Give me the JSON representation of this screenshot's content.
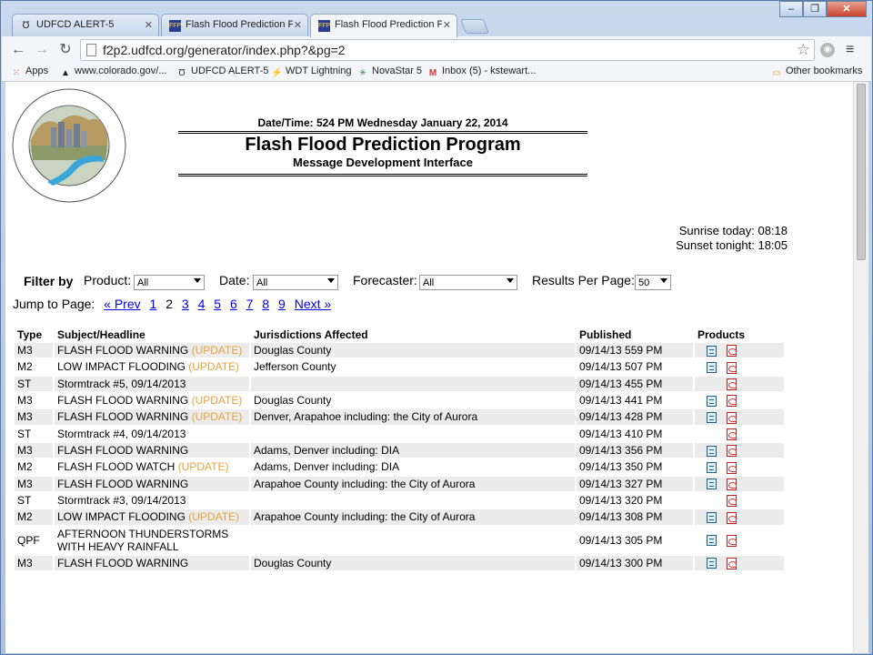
{
  "browser": {
    "tabs": [
      {
        "title": "UDFCD ALERT-5",
        "favicon": "udfcd-logo-icon"
      },
      {
        "title": "Flash Flood Prediction Pro",
        "favicon": "ffp-logo-icon"
      },
      {
        "title": "Flash Flood Prediction Pro",
        "favicon": "ffp-logo-icon",
        "active": true
      }
    ],
    "url": "f2p2.udfcd.org/generator/index.php?&pg=2",
    "bookmarks": [
      {
        "label": "Apps",
        "icon": "apps-grid-icon"
      },
      {
        "label": "www.colorado.gov/...",
        "icon": "colorado-icon"
      },
      {
        "label": "UDFCD ALERT-5",
        "icon": "udfcd-logo-icon"
      },
      {
        "label": "WDT Lightning",
        "icon": "lightning-icon"
      },
      {
        "label": "NovaStar 5",
        "icon": "novastar-icon"
      },
      {
        "label": "Inbox (5) - kstewart...",
        "icon": "gmail-icon"
      }
    ],
    "other_bookmarks": "Other bookmarks"
  },
  "page": {
    "datetime": "Date/Time: 524 PM Wednesday January 22, 2014",
    "title": "Flash Flood Prediction Program",
    "subtitle": "Message Development Interface",
    "sunrise": "Sunrise today: 08:18",
    "sunset": "Sunset tonight: 18:05"
  },
  "filters": {
    "filter_by": "Filter by",
    "product_label": "Product:",
    "product_value": "All",
    "date_label": "Date:",
    "date_value": "All",
    "forecaster_label": "Forecaster:",
    "forecaster_value": "All",
    "results_label": "Results Per Page:",
    "results_value": "50"
  },
  "pager": {
    "jump_label": "Jump to Page:",
    "prev": "« Prev",
    "pages": [
      "1",
      "2",
      "3",
      "4",
      "5",
      "6",
      "7",
      "8",
      "9"
    ],
    "current": "2",
    "next": "Next »"
  },
  "table": {
    "headers": [
      "Type",
      "Subject/Headline",
      "Jurisdictions Affected",
      "Published",
      "Products"
    ],
    "rows": [
      {
        "type": "M3",
        "subject": "FLASH FLOOD WARNING",
        "update": "(UPDATE)",
        "jurisdiction": "Douglas County",
        "published": "09/14/13 559 PM",
        "doc": true,
        "pdf": true
      },
      {
        "type": "M2",
        "subject": "LOW IMPACT FLOODING",
        "update": "(UPDATE)",
        "jurisdiction": "Jefferson County",
        "published": "09/14/13 507 PM",
        "doc": true,
        "pdf": true
      },
      {
        "type": "ST",
        "subject": "Stormtrack #5, 09/14/2013",
        "update": "",
        "jurisdiction": "",
        "published": "09/14/13 455 PM",
        "doc": false,
        "pdf": true
      },
      {
        "type": "M3",
        "subject": "FLASH FLOOD WARNING",
        "update": "(UPDATE)",
        "jurisdiction": "Douglas County",
        "published": "09/14/13 441 PM",
        "doc": true,
        "pdf": true
      },
      {
        "type": "M3",
        "subject": "FLASH FLOOD WARNING",
        "update": "(UPDATE)",
        "jurisdiction": "Denver, Arapahoe including: the City of Aurora",
        "published": "09/14/13 428 PM",
        "doc": true,
        "pdf": true
      },
      {
        "type": "ST",
        "subject": "Stormtrack #4, 09/14/2013",
        "update": "",
        "jurisdiction": "",
        "published": "09/14/13 410 PM",
        "doc": false,
        "pdf": true
      },
      {
        "type": "M3",
        "subject": "FLASH FLOOD WARNING",
        "update": "",
        "jurisdiction": "Adams, Denver including: DIA",
        "published": "09/14/13 356 PM",
        "doc": true,
        "pdf": true
      },
      {
        "type": "M2",
        "subject": "FLASH FLOOD WATCH",
        "update": "(UPDATE)",
        "jurisdiction": "Adams, Denver including: DIA",
        "published": "09/14/13 350 PM",
        "doc": true,
        "pdf": true
      },
      {
        "type": "M3",
        "subject": "FLASH FLOOD WARNING",
        "update": "",
        "jurisdiction": "Arapahoe County including: the City of Aurora",
        "published": "09/14/13 327 PM",
        "doc": true,
        "pdf": true
      },
      {
        "type": "ST",
        "subject": "Stormtrack #3, 09/14/2013",
        "update": "",
        "jurisdiction": "",
        "published": "09/14/13 320 PM",
        "doc": false,
        "pdf": true
      },
      {
        "type": "M2",
        "subject": "LOW IMPACT FLOODING",
        "update": "(UPDATE)",
        "jurisdiction": "Arapahoe County including: the City of Aurora",
        "published": "09/14/13 308 PM",
        "doc": true,
        "pdf": true
      },
      {
        "type": "QPF",
        "subject": "AFTERNOON THUNDERSTORMS WITH HEAVY RAINFALL",
        "update": "",
        "jurisdiction": "",
        "published": "09/14/13 305 PM",
        "doc": true,
        "pdf": true
      },
      {
        "type": "M3",
        "subject": "FLASH FLOOD WARNING",
        "update": "",
        "jurisdiction": "Douglas County",
        "published": "09/14/13 300 PM",
        "doc": true,
        "pdf": true
      }
    ]
  },
  "colors": {
    "update": "#e8a23c",
    "link": "#0000ee",
    "row_alt": "#ececec"
  }
}
